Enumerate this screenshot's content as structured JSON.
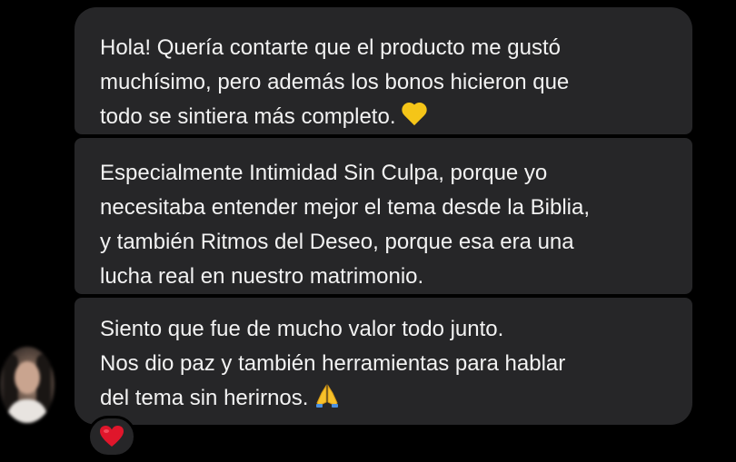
{
  "messages": [
    {
      "lines": [
        "Hola! Quería contarte que el producto me gustó",
        "muchísimo, pero además los bonos hicieron que",
        "todo se sintiera más completo."
      ],
      "trailing_emoji": "yellow-heart-icon"
    },
    {
      "lines": [
        "Especialmente Intimidad Sin Culpa, porque yo",
        "necesitaba entender mejor el tema desde la Biblia,",
        "y también Ritmos del Deseo, porque esa era una",
        "lucha real en nuestro matrimonio."
      ]
    },
    {
      "lines": [
        "Siento que fue de mucho valor todo junto.",
        "Nos dio paz y también herramientas para hablar",
        "del tema sin herirnos."
      ],
      "trailing_emoji": "folded-hands-icon"
    }
  ],
  "reaction": {
    "icon": "red-heart-icon",
    "color": "#e0162b"
  },
  "colors": {
    "background": "#000000",
    "bubble": "#262628",
    "text": "#f2f2f2"
  }
}
